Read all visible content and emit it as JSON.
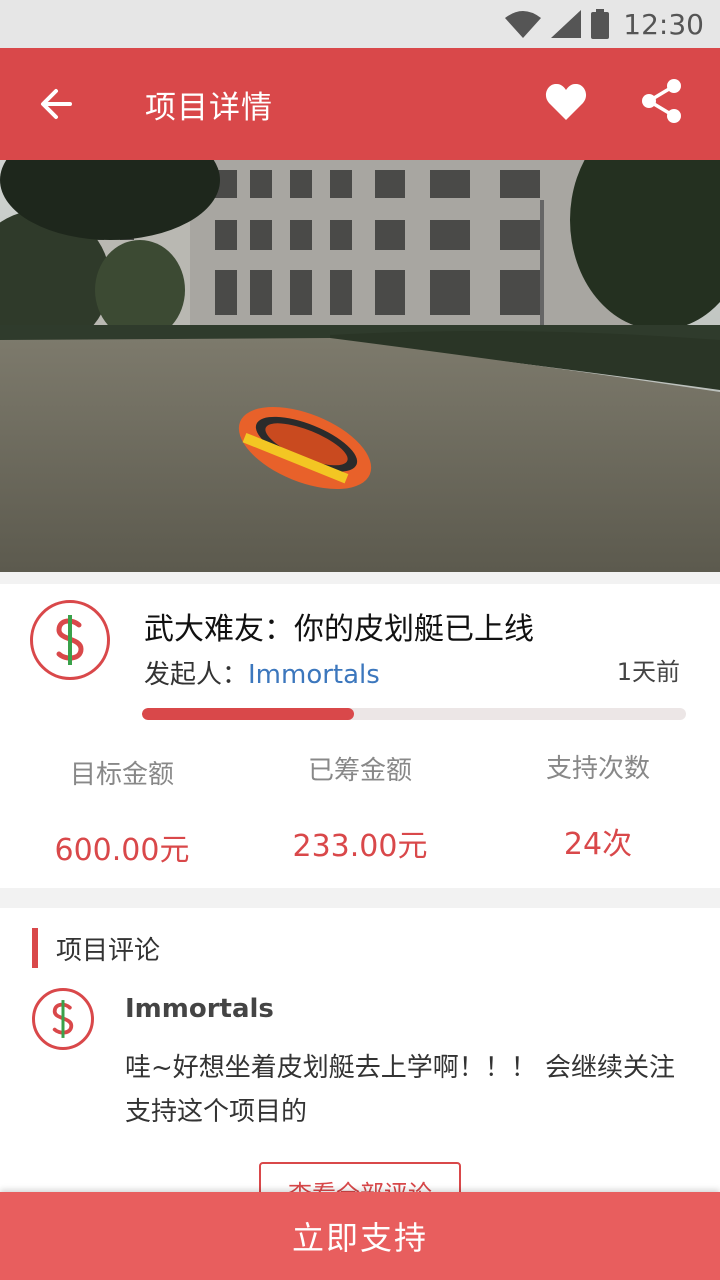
{
  "status_bar": {
    "time": "12:30"
  },
  "app_bar": {
    "title": "项目详情",
    "accent": "#d9484a"
  },
  "project": {
    "title": "武大难友：你的皮划艇已上线",
    "initiator_label": "发起人：",
    "initiator_name": "Immortals",
    "time_ago": "1天前",
    "progress": 0.39,
    "stats": [
      {
        "label": "目标金额",
        "value": "600.00元"
      },
      {
        "label": "已筹金额",
        "value": "233.00元"
      },
      {
        "label": "支持次数",
        "value": "24次"
      }
    ]
  },
  "comments": {
    "section_title": "项目评论",
    "items": [
      {
        "author": "Immortals",
        "text": "哇~好想坐着皮划艇去上学啊！！！ 会继续关注支持这个项目的"
      }
    ],
    "view_all_label": "查看全部评论"
  },
  "support_button": "立即支持",
  "icons": [
    "back-arrow-icon",
    "heart-icon",
    "share-icon",
    "wifi-icon",
    "signal-icon",
    "battery-icon",
    "dollar-logo-icon"
  ]
}
